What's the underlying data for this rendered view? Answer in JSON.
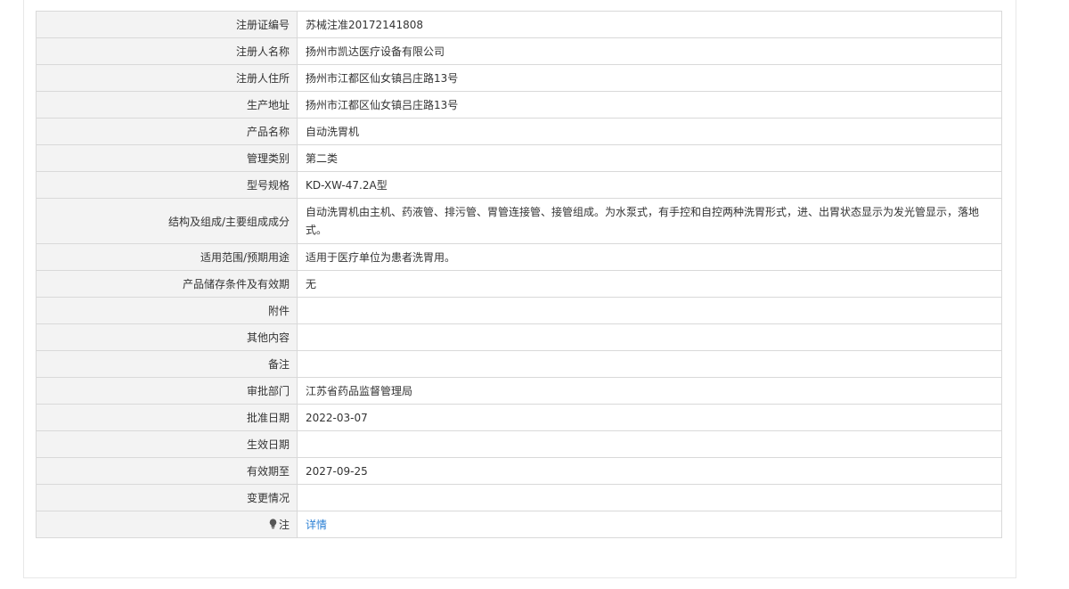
{
  "rows": [
    {
      "label": "注册证编号",
      "value": "苏械注准20172141808"
    },
    {
      "label": "注册人名称",
      "value": "扬州市凯达医疗设备有限公司"
    },
    {
      "label": "注册人住所",
      "value": "扬州市江都区仙女镇吕庄路13号"
    },
    {
      "label": "生产地址",
      "value": "扬州市江都区仙女镇吕庄路13号"
    },
    {
      "label": "产品名称",
      "value": "自动洗胃机"
    },
    {
      "label": "管理类别",
      "value": "第二类"
    },
    {
      "label": "型号规格",
      "value": "KD-XW-47.2A型"
    },
    {
      "label": "结构及组成/主要组成成分",
      "value": "自动洗胃机由主机、药液管、排污管、胃管连接管、接管组成。为水泵式，有手控和自控两种洗胃形式，进、出胃状态显示为发光管显示，落地式。"
    },
    {
      "label": "适用范围/预期用途",
      "value": "适用于医疗单位为患者洗胃用。"
    },
    {
      "label": "产品储存条件及有效期",
      "value": "无"
    },
    {
      "label": "附件",
      "value": ""
    },
    {
      "label": "其他内容",
      "value": ""
    },
    {
      "label": "备注",
      "value": ""
    },
    {
      "label": "审批部门",
      "value": "江苏省药品监督管理局"
    },
    {
      "label": "批准日期",
      "value": "2022-03-07"
    },
    {
      "label": "生效日期",
      "value": ""
    },
    {
      "label": "有效期至",
      "value": "2027-09-25"
    },
    {
      "label": "变更情况",
      "value": ""
    },
    {
      "label": "注",
      "value": "详情"
    }
  ],
  "icons": {
    "note_icon": "lightbulb-icon"
  },
  "colors": {
    "link": "#2a7fd4",
    "label_bg": "#f3f3f3",
    "border": "#d9d9d9"
  }
}
